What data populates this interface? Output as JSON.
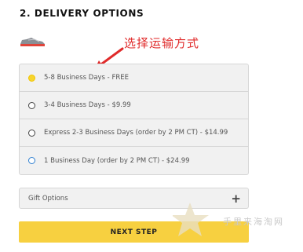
{
  "section_title": "2. DELIVERY OPTIONS",
  "annotation": "选择运输方式",
  "delivery_options": [
    {
      "label": "5-8 Business Days - FREE",
      "selected": true
    },
    {
      "label": "3-4 Business Days - $9.99",
      "selected": false
    },
    {
      "label": "Express 2-3 Business Days (order by 2 PM CT) - $14.99",
      "selected": false
    },
    {
      "label": "1 Business Day (order by 2 PM CT) - $24.99",
      "selected": false
    }
  ],
  "gift_options": {
    "label": "Gift Options",
    "expand_icon": "+"
  },
  "next_step_label": "NEXT STEP",
  "watermark_text": "手里来海淘网",
  "colors": {
    "accent": "#f7d040",
    "annotation": "#e02a2a"
  }
}
